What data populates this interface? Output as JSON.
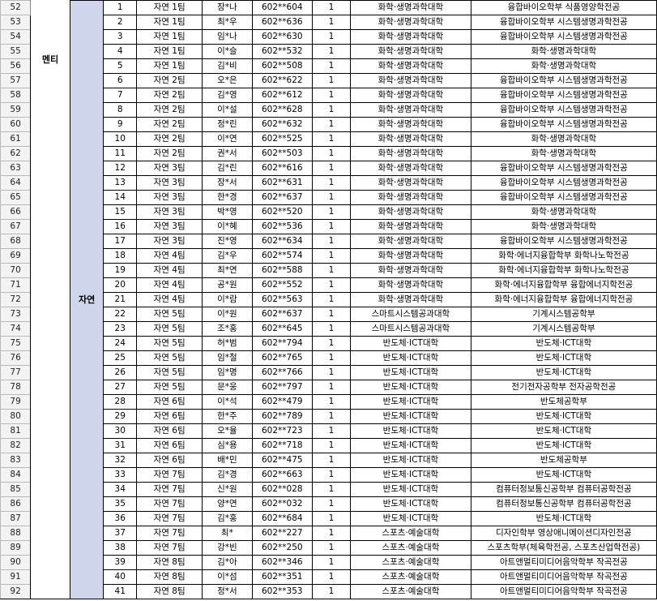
{
  "labels": {
    "category": "멘티",
    "group": "자연"
  },
  "rows": [
    {
      "row": "52",
      "no": "1",
      "team": "자연 1팀",
      "name": "장*나",
      "id": "602**604",
      "count": "1",
      "college": "화학·생명과학대학",
      "dept": "융합바이오학부 식품영양학전공"
    },
    {
      "row": "53",
      "no": "2",
      "team": "자연 1팀",
      "name": "최*우",
      "id": "602**636",
      "count": "1",
      "college": "화학·생명과학대학",
      "dept": "융합바이오학부 시스템생명과학전공"
    },
    {
      "row": "54",
      "no": "3",
      "team": "자연 1팀",
      "name": "임*나",
      "id": "602**630",
      "count": "1",
      "college": "화학·생명과학대학",
      "dept": "융합바이오학부 시스템생명과학전공"
    },
    {
      "row": "55",
      "no": "4",
      "team": "자연 1팀",
      "name": "이*슬",
      "id": "602**532",
      "count": "1",
      "college": "화학·생명과학대학",
      "dept": "화학·생명과학대학"
    },
    {
      "row": "56",
      "no": "5",
      "team": "자연 1팀",
      "name": "김*비",
      "id": "602**508",
      "count": "1",
      "college": "화학·생명과학대학",
      "dept": "화학·생명과학대학"
    },
    {
      "row": "57",
      "no": "6",
      "team": "자연 2팀",
      "name": "오*은",
      "id": "602**622",
      "count": "1",
      "college": "화학·생명과학대학",
      "dept": "융합바이오학부 시스템생명과학전공"
    },
    {
      "row": "58",
      "no": "7",
      "team": "자연 2팀",
      "name": "김*영",
      "id": "602**612",
      "count": "1",
      "college": "화학·생명과학대학",
      "dept": "융합바이오학부 시스템생명과학전공"
    },
    {
      "row": "59",
      "no": "8",
      "team": "자연 2팀",
      "name": "이*설",
      "id": "602**628",
      "count": "1",
      "college": "화학·생명과학대학",
      "dept": "융합바이오학부 시스템생명과학전공"
    },
    {
      "row": "60",
      "no": "9",
      "team": "자연 2팀",
      "name": "정*린",
      "id": "602**632",
      "count": "1",
      "college": "화학·생명과학대학",
      "dept": "융합바이오학부 시스템생명과학전공"
    },
    {
      "row": "61",
      "no": "10",
      "team": "자연 2팀",
      "name": "이*연",
      "id": "602**525",
      "count": "1",
      "college": "화학·생명과학대학",
      "dept": "화학·생명과학대학"
    },
    {
      "row": "62",
      "no": "11",
      "team": "자연 2팀",
      "name": "권*서",
      "id": "602**503",
      "count": "1",
      "college": "화학·생명과학대학",
      "dept": "화학·생명과학대학"
    },
    {
      "row": "63",
      "no": "12",
      "team": "자연 3팀",
      "name": "김*린",
      "id": "602**616",
      "count": "1",
      "college": "화학·생명과학대학",
      "dept": "융합바이오학부 시스템생명과학전공"
    },
    {
      "row": "64",
      "no": "13",
      "team": "자연 3팀",
      "name": "장*서",
      "id": "602**631",
      "count": "1",
      "college": "화학·생명과학대학",
      "dept": "융합바이오학부 시스템생명과학전공"
    },
    {
      "row": "65",
      "no": "14",
      "team": "자연 3팀",
      "name": "한*경",
      "id": "602**637",
      "count": "1",
      "college": "화학·생명과학대학",
      "dept": "융합바이오학부 시스템생명과학전공"
    },
    {
      "row": "66",
      "no": "15",
      "team": "자연 3팀",
      "name": "박*영",
      "id": "602**520",
      "count": "1",
      "college": "화학·생명과학대학",
      "dept": "화학·생명과학대학"
    },
    {
      "row": "67",
      "no": "16",
      "team": "자연 3팀",
      "name": "이*혜",
      "id": "602**536",
      "count": "1",
      "college": "화학·생명과학대학",
      "dept": "화학·생명과학대학"
    },
    {
      "row": "68",
      "no": "17",
      "team": "자연 3팀",
      "name": "진*영",
      "id": "602**634",
      "count": "1",
      "college": "화학·생명과학대학",
      "dept": "융합바이오학부 시스템생명과학전공"
    },
    {
      "row": "69",
      "no": "18",
      "team": "자연 4팀",
      "name": "김*우",
      "id": "602**574",
      "count": "1",
      "college": "화학·생명과학대학",
      "dept": "화학·에너지융합학부 화학나노학전공"
    },
    {
      "row": "70",
      "no": "19",
      "team": "자연 4팀",
      "name": "최*연",
      "id": "602**588",
      "count": "1",
      "college": "화학·생명과학대학",
      "dept": "화학·에너지융합학부 화학나노학전공"
    },
    {
      "row": "71",
      "no": "20",
      "team": "자연 4팀",
      "name": "공*원",
      "id": "602**552",
      "count": "1",
      "college": "화학·생명과학대학",
      "dept": "화학·에너지융합학부 융합에너지학전공"
    },
    {
      "row": "72",
      "no": "21",
      "team": "자연 4팀",
      "name": "이*람",
      "id": "602**563",
      "count": "1",
      "college": "화학·생명과학대학",
      "dept": "화학·에너지융합학부 융합에너지학전공"
    },
    {
      "row": "73",
      "no": "22",
      "team": "자연 5팀",
      "name": "이*원",
      "id": "602**637",
      "count": "1",
      "college": "스마트시스템공과대학",
      "dept": "기계시스템공학부"
    },
    {
      "row": "74",
      "no": "23",
      "team": "자연 5팀",
      "name": "조*홍",
      "id": "602**645",
      "count": "1",
      "college": "스마트시스템공과대학",
      "dept": "기계시스템공학부"
    },
    {
      "row": "75",
      "no": "24",
      "team": "자연 5팀",
      "name": "허*범",
      "id": "602**794",
      "count": "1",
      "college": "반도체·ICT대학",
      "dept": "반도체·ICT대학"
    },
    {
      "row": "76",
      "no": "25",
      "team": "자연 5팀",
      "name": "임*철",
      "id": "602**765",
      "count": "1",
      "college": "반도체·ICT대학",
      "dept": "반도체·ICT대학"
    },
    {
      "row": "77",
      "no": "26",
      "team": "자연 5팀",
      "name": "임*명",
      "id": "602**766",
      "count": "1",
      "college": "반도체·ICT대학",
      "dept": "반도체·ICT대학"
    },
    {
      "row": "78",
      "no": "27",
      "team": "자연 5팀",
      "name": "문*웅",
      "id": "602**797",
      "count": "1",
      "college": "반도체·ICT대학",
      "dept": "전기전자공학부 전자공학전공"
    },
    {
      "row": "79",
      "no": "28",
      "team": "자연 6팀",
      "name": "이*석",
      "id": "602**479",
      "count": "1",
      "college": "반도체·ICT대학",
      "dept": "반도체공학부"
    },
    {
      "row": "80",
      "no": "29",
      "team": "자연 6팀",
      "name": "한*주",
      "id": "602**789",
      "count": "1",
      "college": "반도체·ICT대학",
      "dept": "반도체·ICT대학"
    },
    {
      "row": "81",
      "no": "30",
      "team": "자연 6팀",
      "name": "오*율",
      "id": "602**723",
      "count": "1",
      "college": "반도체·ICT대학",
      "dept": "반도체·ICT대학"
    },
    {
      "row": "82",
      "no": "31",
      "team": "자연 6팀",
      "name": "심*용",
      "id": "602**718",
      "count": "1",
      "college": "반도체·ICT대학",
      "dept": "반도체·ICT대학"
    },
    {
      "row": "83",
      "no": "32",
      "team": "자연 6팀",
      "name": "배*민",
      "id": "602**475",
      "count": "1",
      "college": "반도체·ICT대학",
      "dept": "반도체공학부"
    },
    {
      "row": "84",
      "no": "33",
      "team": "자연 7팀",
      "name": "김*경",
      "id": "602**663",
      "count": "1",
      "college": "반도체·ICT대학",
      "dept": "반도체·ICT대학"
    },
    {
      "row": "85",
      "no": "34",
      "team": "자연 7팀",
      "name": "신*원",
      "id": "602**028",
      "count": "1",
      "college": "반도체·ICT대학",
      "dept": "컴퓨터정보통신공학부 컴퓨터공학전공"
    },
    {
      "row": "86",
      "no": "35",
      "team": "자연 7팀",
      "name": "양*연",
      "id": "602**032",
      "count": "1",
      "college": "반도체·ICT대학",
      "dept": "컴퓨터정보통신공학부 컴퓨터공학전공"
    },
    {
      "row": "87",
      "no": "36",
      "team": "자연 7팀",
      "name": "김*홍",
      "id": "602**684",
      "count": "1",
      "college": "반도체·ICT대학",
      "dept": "반도체·ICT대학"
    },
    {
      "row": "88",
      "no": "37",
      "team": "자연 7팀",
      "name": "최*",
      "id": "602**227",
      "count": "1",
      "college": "스포츠·예술대학",
      "dept": "디자인학부 영상애니메이션디자인전공"
    },
    {
      "row": "89",
      "no": "38",
      "team": "자연 7팀",
      "name": "강*빈",
      "id": "602**250",
      "count": "1",
      "college": "스포츠·예술대학",
      "dept": "스포츠학부(체육학전공, 스포츠산업학전공)"
    },
    {
      "row": "90",
      "no": "39",
      "team": "자연 8팀",
      "name": "김*아",
      "id": "602**346",
      "count": "1",
      "college": "스포츠·예술대학",
      "dept": "아트앤멀티미디어음악학부 작곡전공"
    },
    {
      "row": "91",
      "no": "40",
      "team": "자연 8팀",
      "name": "이*섬",
      "id": "602**351",
      "count": "1",
      "college": "스포츠·예술대학",
      "dept": "아트앤멀티미디어음악학부 작곡전공"
    },
    {
      "row": "92",
      "no": "41",
      "team": "자연 8팀",
      "name": "정*서",
      "id": "602**353",
      "count": "1",
      "college": "스포츠·예술대학",
      "dept": "아트앤멀티미디어음악학부 작곡전공"
    }
  ]
}
